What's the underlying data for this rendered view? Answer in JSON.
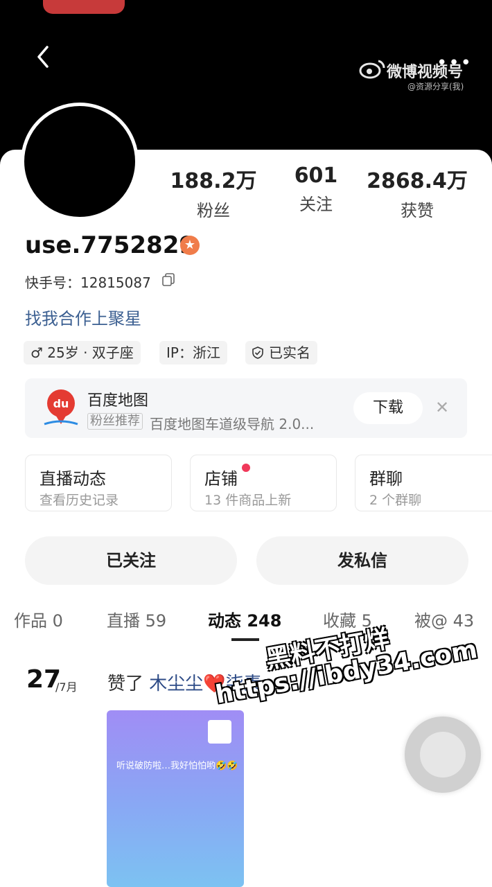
{
  "header": {
    "watermark_brand": "微博视频号",
    "watermark_handle": "@资源分享(我)"
  },
  "profile": {
    "stats": [
      {
        "value": "188.2万",
        "label": "粉丝"
      },
      {
        "value": "601",
        "label": "关注"
      },
      {
        "value": "2868.4万",
        "label": "获赞"
      }
    ],
    "username": "use.7752829",
    "badge_glyph": "★",
    "kuaishou_id": "快手号：12815087",
    "bio": "找我合作上聚星",
    "tags": [
      "♂ 25岁 · 双子座",
      "IP：浙江",
      "已实名"
    ]
  },
  "ad": {
    "app_name": "百度地图",
    "logo_text": "du",
    "rec_label": "粉丝推荐",
    "description": "百度地图车道级导航 2.0...",
    "download_label": "下载",
    "close_glyph": "✕"
  },
  "tiles": [
    {
      "title": "直播动态",
      "subtitle": "查看历史记录"
    },
    {
      "title": "店铺",
      "subtitle": "13 件商品上新"
    },
    {
      "title": "群聊",
      "subtitle": "2 个群聊"
    }
  ],
  "actions": {
    "following_label": "已关注",
    "message_label": "发私信"
  },
  "tabs": [
    "作品 0",
    "直播 59",
    "动态 248",
    "收藏 5",
    "被@ 43"
  ],
  "feed": {
    "day": "27",
    "month": "/7月",
    "action_prefix": "赞了 ",
    "action_user": "木尘尘❤️柒素",
    "thumb_text": "听说破防啦…我好怕怕哟🤣🤣"
  },
  "watermark": {
    "line1": "黑料不打烊",
    "line2": "https://ibdy34.com"
  },
  "colors": {
    "link": "#3b5f91",
    "badge": "#f07c4a",
    "notify_dot": "#f0395a"
  }
}
